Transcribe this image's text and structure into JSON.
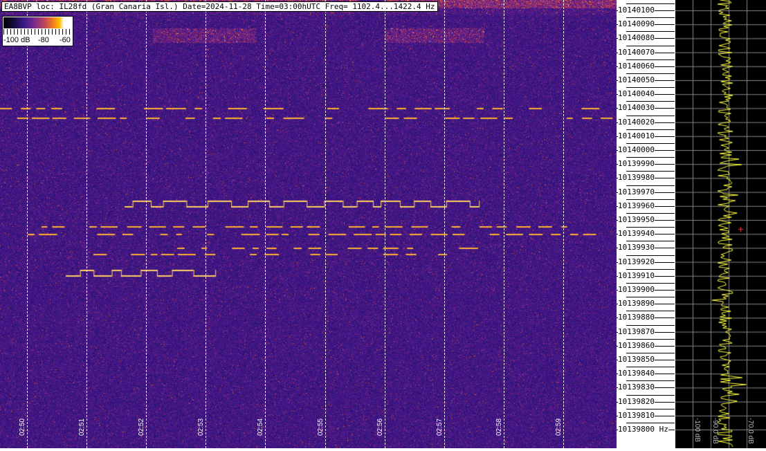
{
  "title": "EA8BVP loc: IL28fd (Gran Canaria Isl.) Date=2024-11-28 Time=03:00hUTC Freq= 1102.4...1422.4 Hz",
  "colorbar": {
    "labels": [
      "-100 dB",
      "-80",
      "-60"
    ]
  },
  "chart_data": {
    "type": "heatmap",
    "title": "EA8BVP loc: IL28fd (Gran Canaria Isl.) Date=2024-11-28 Time=03:00hUTC Freq= 1102.4...1422.4 Hz",
    "x_ticks": [
      "02:50",
      "02:51",
      "02:52",
      "02:53",
      "02:54",
      "02:55",
      "02:56",
      "02:57",
      "02:58",
      "02:59"
    ],
    "y_ticks": [
      "10140100",
      "10140090",
      "10140080",
      "10140070",
      "10140060",
      "10140050",
      "10140040",
      "10140030",
      "10140020",
      "10140010",
      "10140000",
      "10139990",
      "10139980",
      "10139970",
      "10139960",
      "10139950",
      "10139940",
      "10139930",
      "10139920",
      "10139910",
      "10139900",
      "10139890",
      "10139880",
      "10139870",
      "10139860",
      "10139850",
      "10139840",
      "10139830",
      "10139820",
      "10139810",
      "10139800 Hz"
    ],
    "colorbar_range_db": [
      -100,
      -60
    ],
    "spectrum_axis_labels": [
      "-100 dB",
      "-90.0 dB",
      "-70.0 dB"
    ],
    "colors": {
      "background": "#2a1470",
      "signal": "#ffb020",
      "spectrum_trace": "#ffff40"
    }
  }
}
